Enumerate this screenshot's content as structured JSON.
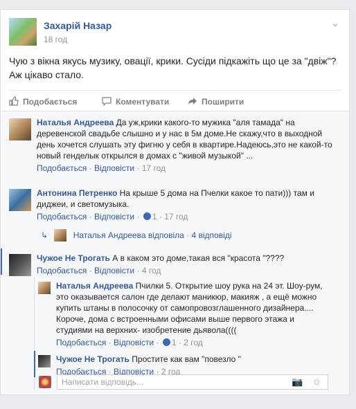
{
  "post": {
    "author": "Захарій Назар",
    "time": "18 год",
    "text": "Чую з вікна якусь музику, овації, крики. Сусіди підкажіть що це за \"двіж\"? Аж цікаво стало."
  },
  "actions": {
    "like": "Подобається",
    "comment": "Коментувати",
    "share": "Поширити"
  },
  "comments": [
    {
      "author": "Наталья Андреева",
      "text": "Да уж,крики какого-то мужика \"аля тамада\" на деревенской свадьбе слышно и у нас в 5м доме.Не скажу,что в выходной день хочется слушать эту фигню у себя в квартире.Надеюсь,это не какой-то новый генделык открылся в домах с \"живой музыкой\" ...",
      "like": "Подобається",
      "reply": "Відповісти",
      "time": "17 год"
    },
    {
      "author": "Антонина Петренко",
      "text": "На крыше 5 дома на Пчелки какое то пати))) там и диджеи, и светомузыка.",
      "like": "Подобається",
      "reply": "Відповісти",
      "likes": "1",
      "time": "17 год",
      "replies_author": "Наталья Андреева",
      "replies_text": "відповіла",
      "replies_count": "4 відповіді"
    },
    {
      "author": "Чужое Не Трогать",
      "text": "А в каком это доме,такая вся \"красота \"????",
      "like": "Подобається",
      "reply": "Відповісти",
      "time": "4 год",
      "replies": [
        {
          "author": "Наталья Андреева",
          "text": "Пчилки 5. Открытие шоу рука на 24 эт. Шоу-рум, это оказывается салон где делают маникюр, макияж , а ещё можно купить штаны в полосочку от самопровозглашенного дизайнера.... Короче, дома с встроенными офисами выше первого этажа и студиями на верхних- изобретение дьявола((((",
          "like": "Подобається",
          "reply": "Відповісти",
          "likes": "1",
          "time": "2 год"
        },
        {
          "author": "Чужое Не Трогать",
          "text": "Простите как вам \"повезло \"",
          "like": "Подобається",
          "reply": "Відповісти",
          "time": "2 год"
        }
      ]
    }
  ],
  "composer": {
    "placeholder": "Написати відповідь..."
  }
}
